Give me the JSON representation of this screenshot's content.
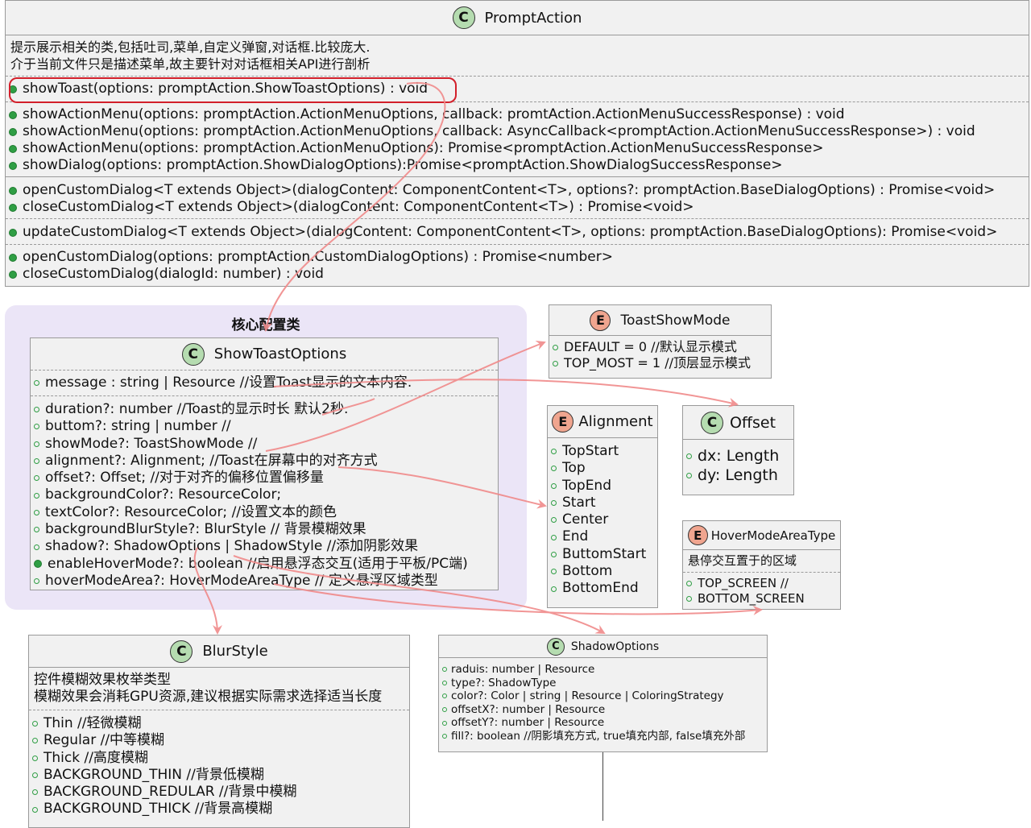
{
  "prompt_action": {
    "badge": "C",
    "title": "PromptAction",
    "notes": [
      "提示展示相关的类,包括吐司,菜单,自定义弹窗,对话框.比较庞大.",
      "介于当前文件只是描述菜单,故主要针对对话框相关API进行剖析"
    ],
    "sections": [
      [
        "showToast(options: promptAction.ShowToastOptions) : void"
      ],
      [
        "showActionMenu(options: promptAction.ActionMenuOptions, callback: promtAction.ActionMenuSuccessResponse) : void",
        "showActionMenu(options: promptAction.ActionMenuOptions, callback: AsyncCallback<promptAction.ActionMenuSuccessResponse>) : void",
        "showActionMenu(options: promptAction.ActionMenuOptions): Promise<promptAction.ActionMenuSuccessResponse>",
        "showDialog(options: promptAction.ShowDialogOptions):Promise<promptAction.ShowDialogSuccessResponse>"
      ],
      [
        "openCustomDialog<T extends Object>(dialogContent: ComponentContent<T>, options?: promptAction.BaseDialogOptions) : Promise<void>",
        "closeCustomDialog<T extends Object>(dialogContent: ComponentContent<T>) : Promise<void>"
      ],
      [
        "updateCustomDialog<T extends Object>(dialogContent: ComponentContent<T>, options: promptAction.BaseDialogOptions): Promise<void>"
      ],
      [
        "openCustomDialog(options: promptAction.CustomDialogOptions) : Promise<number>",
        "closeCustomDialog(dialogId: number) : void"
      ]
    ]
  },
  "package": {
    "title": "核心配置类"
  },
  "show_toast_options": {
    "badge": "C",
    "title": "ShowToastOptions",
    "sections": [
      [
        "message : string | Resource //设置Toast显示的文本内容."
      ],
      [
        "duration?: number //Toast的显示时长 默认2秒.",
        "buttom?: string | number //",
        "showMode?: ToastShowMode //",
        "alignment?: Alignment; //Toast在屏幕中的对齐方式",
        "offset?: Offset; //对于对齐的偏移位置偏移量",
        "backgroundColor?: ResourceColor;",
        "textColor?: ResourceColor; //设置文本的颜色",
        "backgroundBlurStyle?: BlurStyle // 背景模糊效果",
        "shadow?: ShadowOptions | ShadowStyle //添加阴影效果",
        "enableHoverMode?: boolean //启用悬浮态交互(适用于平板/PC端)",
        "hoverModeArea?: HoverModeAreaType // 定义悬浮区域类型"
      ]
    ]
  },
  "toast_show_mode": {
    "badge": "E",
    "title": "ToastShowMode",
    "items": [
      "DEFAULT = 0 //默认显示模式",
      "TOP_MOST = 1 //顶层显示模式"
    ]
  },
  "alignment": {
    "badge": "E",
    "title": "Alignment",
    "items": [
      "TopStart",
      "Top",
      "TopEnd",
      "Start",
      "Center",
      "End",
      "ButtomStart",
      "Bottom",
      "BottomEnd"
    ]
  },
  "offset": {
    "badge": "C",
    "title": "Offset",
    "items": [
      "dx: Length",
      "dy: Length"
    ]
  },
  "hover_mode_area_type": {
    "badge": "E",
    "title": "HoverModeAreaType",
    "note": "悬停交互置于的区域",
    "items": [
      "TOP_SCREEN //",
      "BOTTOM_SCREEN"
    ]
  },
  "blur_style": {
    "badge": "C",
    "title": "BlurStyle",
    "notes": [
      "控件模糊效果枚举类型",
      "模糊效果会消耗GPU资源,建议根据实际需求选择适当长度"
    ],
    "items": [
      "Thin //轻微模糊",
      "Regular //中等模糊",
      "Thick //高度模糊",
      "BACKGROUND_THIN //背景低模糊",
      "BACKGROUND_REDULAR //背景中模糊",
      "BACKGROUND_THICK //背景高模糊"
    ]
  },
  "shadow_options": {
    "badge": "C",
    "title": "ShadowOptions",
    "items": [
      "raduis: number | Resource",
      "type?: ShadowType",
      "color?: Color | string | Resource | ColoringStrategy",
      "offsetX?: number | Resource",
      "offsetY?: number | Resource",
      "fill?: boolean //阴影填充方式, true填充内部, false填充外部"
    ]
  },
  "colors": {
    "arrow": "#f08a8a",
    "highlight": "#d21f2a",
    "package_bg": "#ebe5f7",
    "class_bg": "#f1f1f1"
  }
}
